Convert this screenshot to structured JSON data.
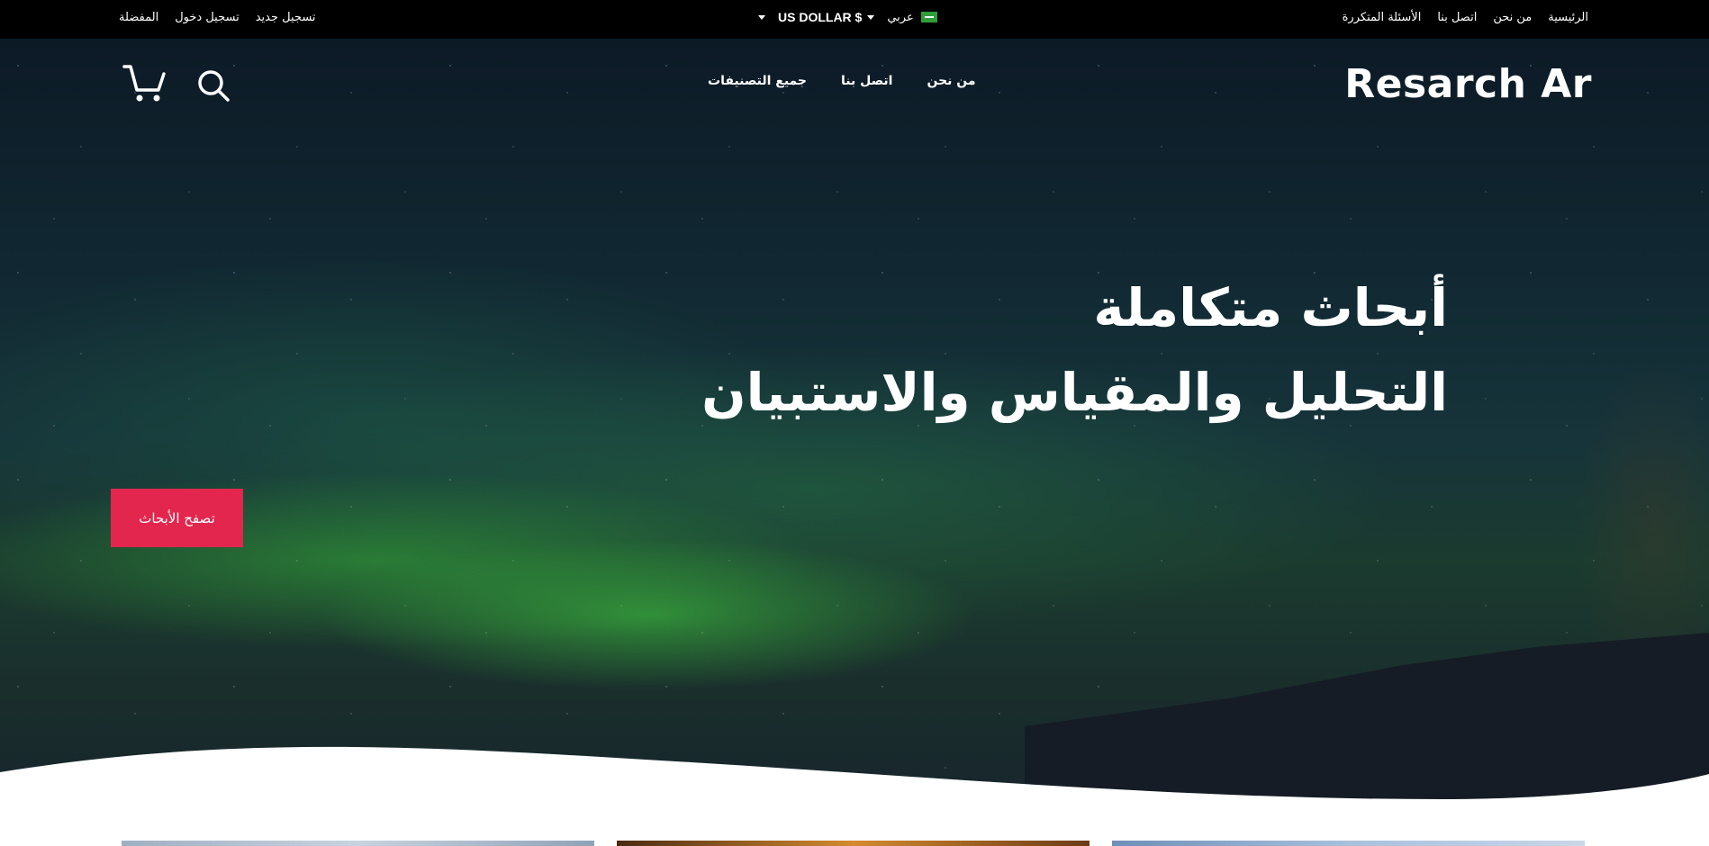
{
  "topbar": {
    "account_links": [
      "تسجيل جديد",
      "تسجيل دخول",
      "المفضلة"
    ],
    "currency": "US DOLLAR $",
    "language": "عربي",
    "site_links": [
      "الرئيسية",
      "من نحن",
      "اتصل بنا",
      "الأسئلة المتكررة"
    ]
  },
  "header": {
    "logo": "Resarch Ar",
    "nav": [
      "من نحن",
      "اتصل بنا",
      "جميع التصنيفات"
    ]
  },
  "hero": {
    "title_line1": "أبحاث متكاملة",
    "title_line2": "التحليل والمقياس والاستبيان",
    "cta_label": "تصفح الأبحاث"
  },
  "icons": {
    "cart": "cart-icon",
    "search": "search-icon",
    "flag": "saudi-flag-icon",
    "dropdown": "chevron-down-icon"
  },
  "colors": {
    "topbar_bg": "#000000",
    "accent": "#e2264d",
    "text": "#ffffff"
  }
}
